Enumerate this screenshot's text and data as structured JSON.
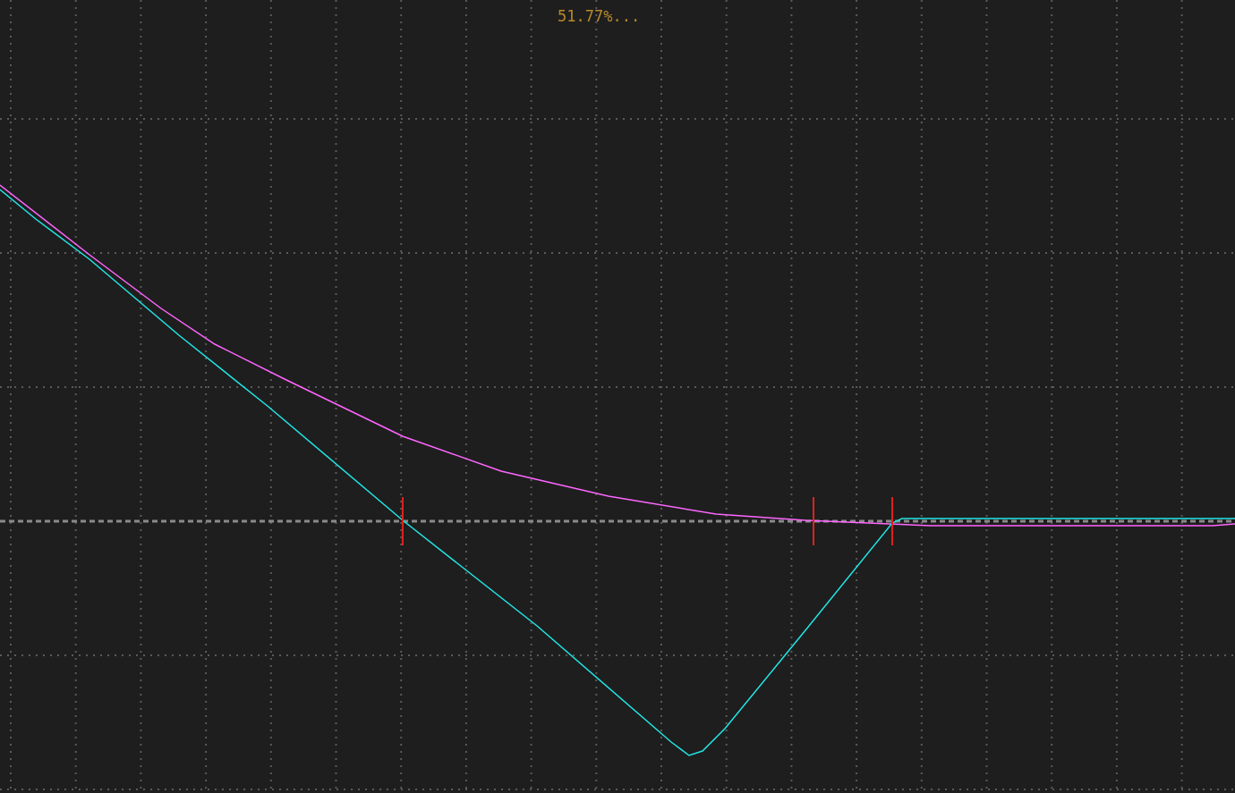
{
  "chart": {
    "label": "51.77%..."
  }
}
